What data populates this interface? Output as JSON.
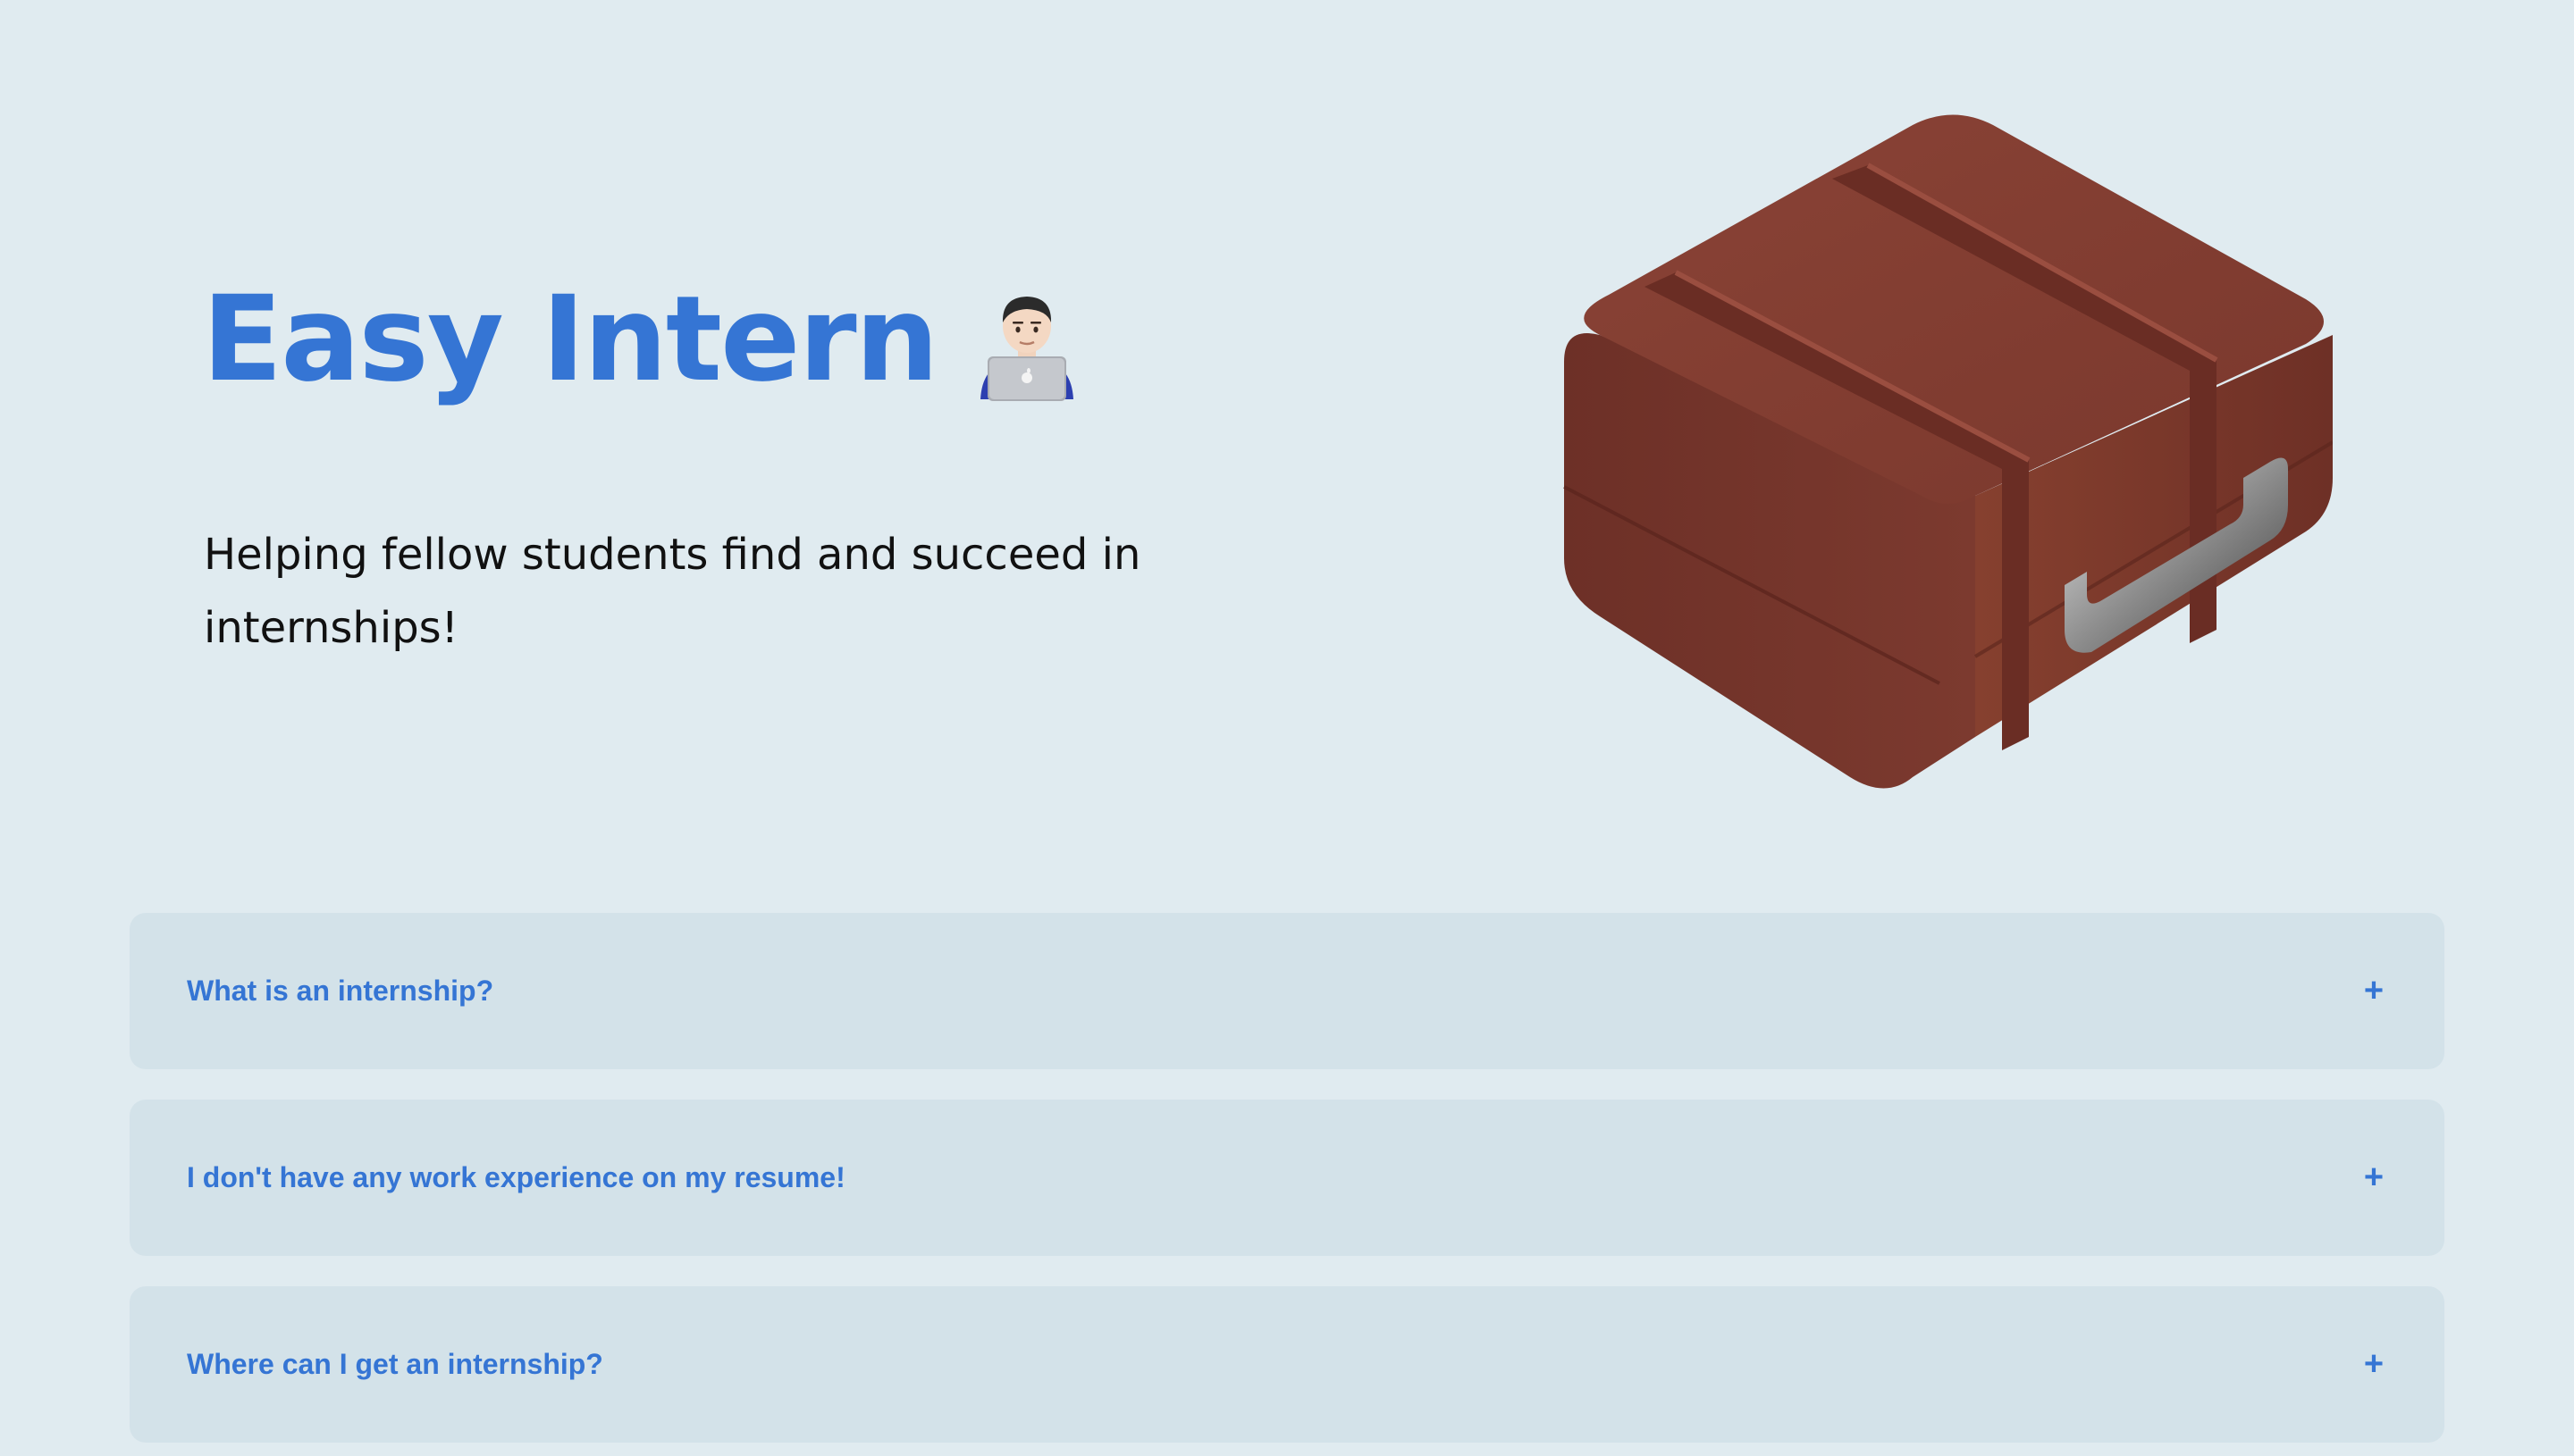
{
  "hero": {
    "title": "Easy Intern",
    "title_emoji": "technologist-icon",
    "subtitle": "Helping fellow students find and succeed in internships!",
    "illustration": "briefcase-icon"
  },
  "faq": {
    "items": [
      {
        "question": "What is an internship?",
        "toggle": "+"
      },
      {
        "question": "I don't have any work experience on my resume!",
        "toggle": "+"
      },
      {
        "question": "Where can I get an internship?",
        "toggle": "+"
      }
    ]
  },
  "colors": {
    "background": "#e0ebf0",
    "accent": "#3575d4",
    "card": "#d3e2e9",
    "briefcase": "#7a3b30"
  }
}
